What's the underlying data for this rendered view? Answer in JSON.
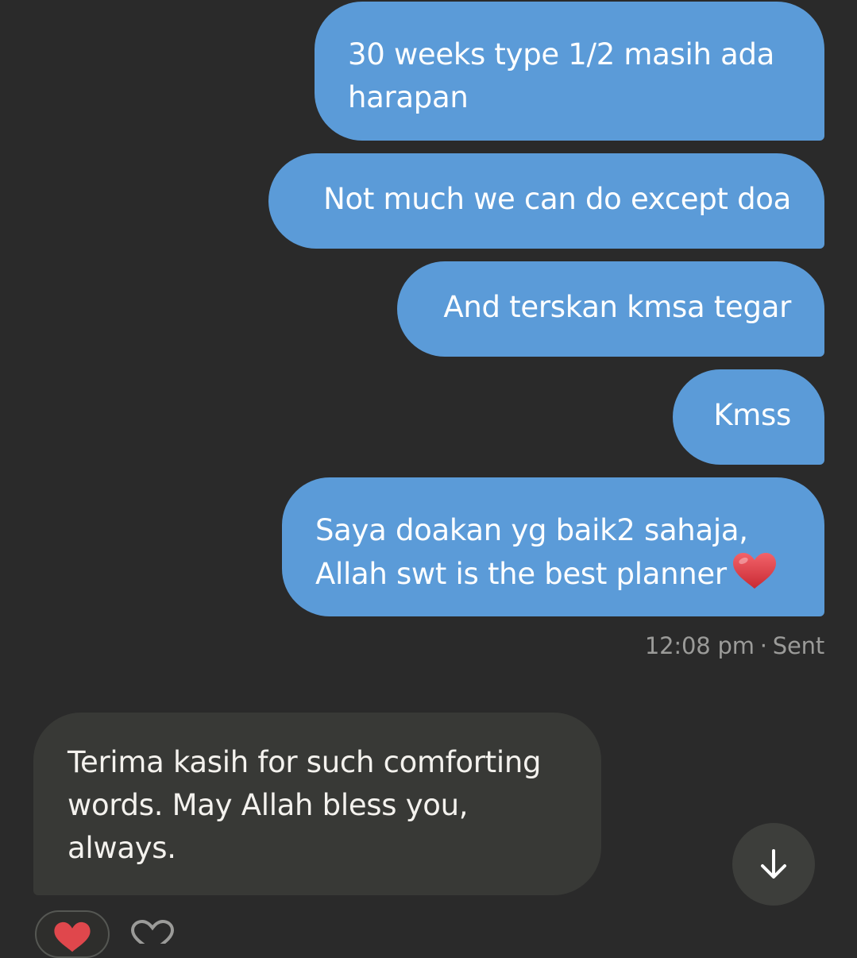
{
  "messages": {
    "sent": [
      {
        "text": "30 weeks type 1/2 masih ada harapan"
      },
      {
        "text": "Not much we can do except doa"
      },
      {
        "text": "And terskan kmsa tegar"
      },
      {
        "text": "Kmss"
      },
      {
        "text": "Saya doakan yg baik2 sahaja, Allah swt is the best planner",
        "emoji": "heart-emoji"
      }
    ],
    "sent_meta": {
      "time": "12:08 pm",
      "separator": "·",
      "status": "Sent"
    },
    "received": [
      {
        "text": "Terima kasih for such comforting words. May Allah bless you, always."
      }
    ]
  },
  "reactions": {
    "existing": "heart-icon",
    "add": "add-reaction-icon"
  },
  "controls": {
    "scroll_down": "arrow-down-icon"
  },
  "colors": {
    "background": "#2a2a2a",
    "sent_bubble": "#5b9bd8",
    "received_bubble": "#383936",
    "meta_text": "#9b9b99",
    "heart": "#e0474c"
  }
}
